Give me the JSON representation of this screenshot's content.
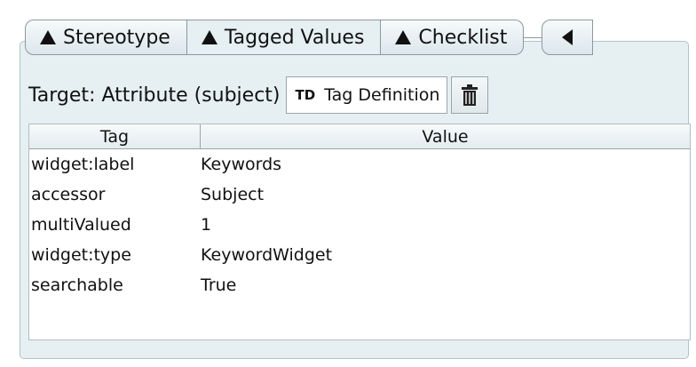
{
  "tabs": [
    {
      "label": "Stereotype",
      "icon": "triangle-up-icon"
    },
    {
      "label": "Tagged Values",
      "icon": "triangle-up-icon",
      "selected": true
    },
    {
      "label": "Checklist",
      "icon": "triangle-up-icon"
    }
  ],
  "tab_scroll_icon": "triangle-left-icon",
  "target": {
    "label": "Target: Attribute (subject)",
    "tag_definition_button": {
      "abbr": "TD",
      "label": "Tag Definition"
    },
    "delete_icon": "trash-icon"
  },
  "table": {
    "columns": [
      "Tag",
      "Value"
    ],
    "rows": [
      {
        "tag": "widget:label",
        "value": "Keywords"
      },
      {
        "tag": "accessor",
        "value": "Subject"
      },
      {
        "tag": "multiValued",
        "value": "1"
      },
      {
        "tag": "widget:type",
        "value": "KeywordWidget"
      },
      {
        "tag": "searchable",
        "value": "True"
      }
    ]
  },
  "colors": {
    "panel_background": "#e6f0f3",
    "border": "#8b989e"
  }
}
